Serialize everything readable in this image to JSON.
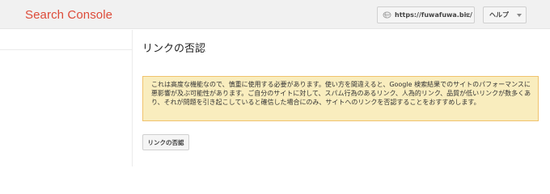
{
  "header": {
    "brand": "Search Console",
    "site_selector": {
      "label": "https://fuwafuwa.biz/",
      "icon": "globe-icon"
    },
    "help": {
      "label": "ヘルプ"
    }
  },
  "main": {
    "title": "リンクの否認",
    "warning": "これは高度な機能なので、慎重に使用する必要があります。使い方を間違えると、Google 検索結果でのサイトのパフォーマンスに悪影響が及ぶ可能性があります。ご自分のサイトに対して、スパム行為のあるリンク、人為的リンク、品質が低いリンクが数多くあり、それが問題を引き起こしていると確信した場合にのみ、サイトへのリンクを否認することをおすすめします。",
    "button": "リンクの否認"
  },
  "colors": {
    "brand": "#dd4b39",
    "warning_bg": "#f9edbe",
    "warning_border": "#f0c36d"
  }
}
